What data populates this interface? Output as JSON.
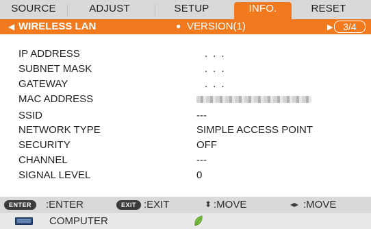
{
  "tabs": [
    {
      "label": "SOURCE",
      "active": false
    },
    {
      "label": "ADJUST",
      "active": false
    },
    {
      "label": "SETUP",
      "active": false
    },
    {
      "label": "INFO.",
      "active": true
    },
    {
      "label": "RESET",
      "active": false
    }
  ],
  "subheader": {
    "current": "WIRELESS LAN",
    "next": "VERSION(1)",
    "page": "3/4"
  },
  "rows": [
    {
      "label": "IP ADDRESS",
      "value": "..."
    },
    {
      "label": "SUBNET MASK",
      "value": "..."
    },
    {
      "label": "GATEWAY",
      "value": "..."
    },
    {
      "label": "MAC ADDRESS",
      "value": ""
    },
    {
      "label": "SSID",
      "value": "---"
    },
    {
      "label": "NETWORK TYPE",
      "value": "SIMPLE ACCESS POINT"
    },
    {
      "label": "SECURITY",
      "value": "OFF"
    },
    {
      "label": "CHANNEL",
      "value": "---"
    },
    {
      "label": "SIGNAL LEVEL",
      "value": "0"
    }
  ],
  "help": {
    "enter_key": "ENTER",
    "enter_text": ":ENTER",
    "exit_key": "EXIT",
    "exit_text": ":EXIT",
    "move_ud_text": ":MOVE",
    "move_lr_text": ":MOVE"
  },
  "source": {
    "label": "COMPUTER",
    "icon": "monitor-icon",
    "eco_icon": "leaf-icon"
  },
  "colors": {
    "accent": "#f27a1e",
    "bar_bg": "#d9d9d9"
  }
}
